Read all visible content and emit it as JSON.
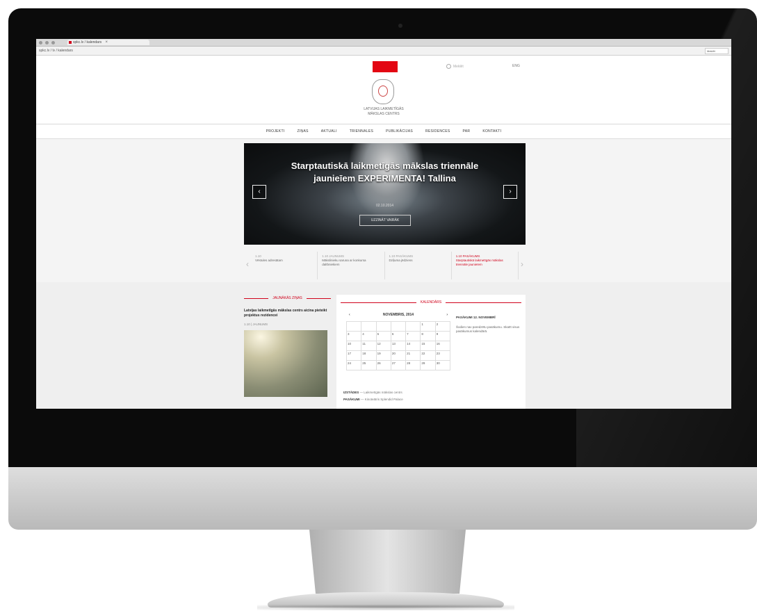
{
  "browser": {
    "tab_title": "spkc.lv / kalendars",
    "tab_close": "×",
    "url": "spkc.lv / lv / kalendars",
    "search_placeholder": "Meklēt"
  },
  "site": {
    "search_label": "Meklēt",
    "language": "ENG",
    "logo_title": "LATVIJAS LAIKMETĪGĀS MĀKSLAS CENTRS",
    "accent_color": "#e30613"
  },
  "nav": {
    "items": [
      "PROJEKTI",
      "ZIŅAS",
      "AKTUALI",
      "TRIENNALES",
      "PUBLIKĀCIJAS",
      "RESIDENCES",
      "PAR",
      "KONTAKTI"
    ]
  },
  "slider": {
    "title": "Starptautiskā laikmetīgās mākslas triennāle jaunieīem EXPERIMENTA! Tallina",
    "date": "02.10.2014",
    "button": "UZZINĀT VAIRĀK",
    "prev_icon": "‹",
    "next_icon": "›"
  },
  "thumbs": {
    "prev_icon": "‹",
    "next_icon": "›",
    "items": [
      {
        "date": "1.10",
        "text": "Vēstules adresātam"
      },
      {
        "date": "1.10 JAUNUMS",
        "text": "Mākslinieku saruna ar konkursa dalībniekiem"
      },
      {
        "date": "1.10 PASĀKUMS",
        "text": "Dziļuma jēdziens"
      },
      {
        "date": "1.10 PASĀKUMS",
        "text": "Starptautiskā laikmetīgās mākslas triennāle jaunieīem"
      }
    ]
  },
  "news": {
    "heading": "JAUNĀKĀS ZIŅAS",
    "title": "Latvijas laikmetīgās mākslas centrs aicina pieteikt projektus rezidencei",
    "meta": "1.10 | JAUNUMS"
  },
  "calendar": {
    "heading": "KALENDĀRS",
    "month": "NOVEMBRIS, 2014",
    "prev_icon": "‹",
    "next_icon": "›",
    "days": [
      "",
      "",
      "",
      "",
      "",
      "1",
      "2",
      "3",
      "4",
      "5",
      "6",
      "7",
      "8",
      "9",
      "10",
      "11",
      "12",
      "13",
      "14",
      "15",
      "16",
      "17",
      "18",
      "19",
      "20",
      "21",
      "22",
      "23",
      "24",
      "25",
      "26",
      "27",
      "28",
      "29",
      "30"
    ],
    "legend": [
      {
        "label": "IZSTĀDES",
        "text": "— Laikmetīgās mākslas centrs"
      },
      {
        "label": "PASĀKUMI",
        "text": "— Kinoteātris Splendid Palace"
      }
    ],
    "side_title": "PASĀKUMI 12. NOVEMBRĪ",
    "side_text": "Šodien nav paredzētu pasākumu. Skatīt visus pasākumus kalendārā."
  }
}
